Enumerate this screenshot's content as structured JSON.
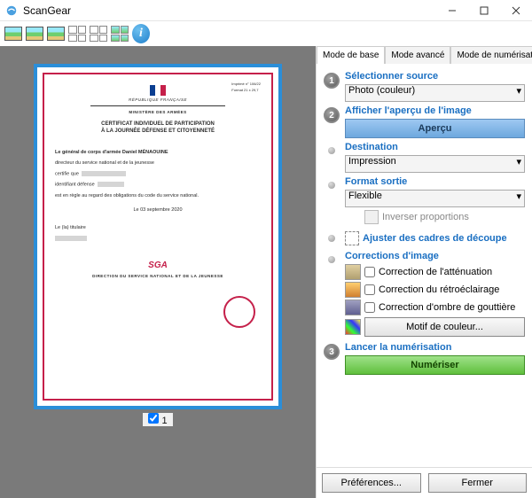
{
  "window": {
    "title": "ScanGear"
  },
  "tabs": {
    "basic": "Mode de base",
    "advanced": "Mode avancé",
    "auto": "Mode de numérisation automatique"
  },
  "steps": {
    "s1": {
      "num": "1",
      "title": "Sélectionner source",
      "value": "Photo (couleur)"
    },
    "s2": {
      "num": "2",
      "title": "Afficher l'aperçu de l'image",
      "button": "Aperçu"
    },
    "dest": {
      "title": "Destination",
      "value": "Impression"
    },
    "fmt": {
      "title": "Format sortie",
      "value": "Flexible",
      "invert": "Inverser proportions"
    },
    "crop": {
      "link": "Ajuster des cadres de découpe"
    },
    "corr": {
      "title": "Corrections d'image",
      "c1": "Correction de l'atténuation",
      "c2": "Correction du rétroéclairage",
      "c3": "Correction d'ombre de gouttière",
      "pattern": "Motif de couleur..."
    },
    "s3": {
      "num": "3",
      "title": "Lancer la numérisation",
      "button": "Numériser"
    }
  },
  "footer": {
    "prefs": "Préférences...",
    "close": "Fermer"
  },
  "preview": {
    "page": "1"
  },
  "doc": {
    "republique": "RÉPUBLIQUE FRANÇAISE",
    "ministere": "MINISTÈRE DES ARMÉES",
    "t1": "CERTIFICAT INDIVIDUEL DE PARTICIPATION",
    "t2": "À LA JOURNÉE DÉFENSE ET CITOYENNETÉ",
    "gen1": "Le général de corps d'armée Daniel MÉNAOUINE",
    "gen2": "directeur du service national et de la jeunesse",
    "certifie": "certifie que",
    "ident": "identifiant défense",
    "regle": "est en règle au regard des obligations du code du service national.",
    "date": "Le   03 septembre 2020",
    "titulaire": "Le (la) titulaire",
    "sga": "SGA",
    "direction": "DIRECTION DU SERVICE NATIONAL ET DE LA JEUNESSE",
    "imprime": "Imprimé n° 106/22",
    "format": "Format 21 x 29,7"
  }
}
